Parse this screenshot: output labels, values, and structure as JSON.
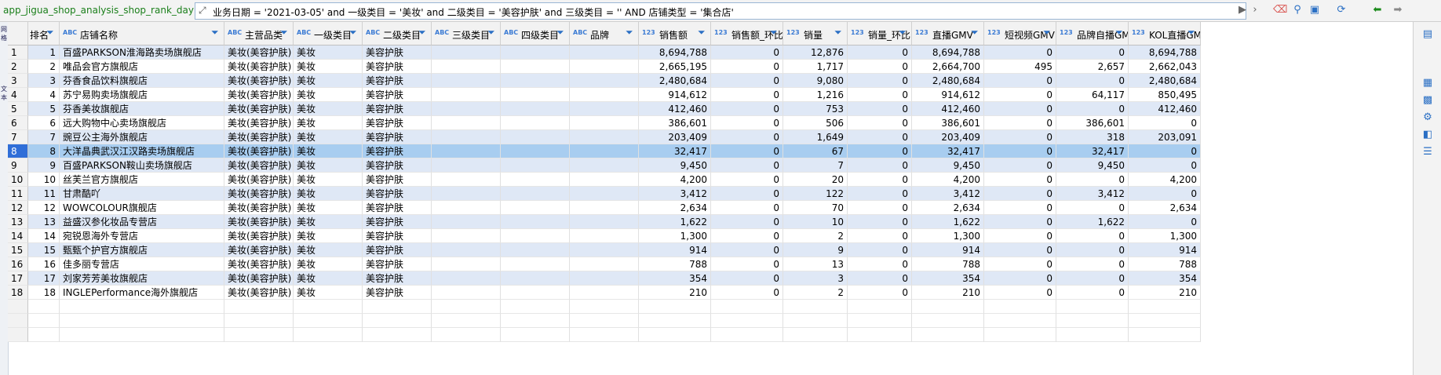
{
  "toolbar": {
    "table_name": "app_jigua_shop_analysis_shop_rank_day",
    "filter_text": "业务日期 = '2021-03-05' and 一级类目 = '美妆' and 二级类目 = '美容护肤' and 三级类目 = '' AND 店铺类型 = '集合店'",
    "icons": [
      "expand-icon",
      "play-icon",
      "next-icon",
      "eraser-icon",
      "filter-icon",
      "save-icon",
      "refresh-icon",
      "back-icon",
      "forward-icon"
    ]
  },
  "left_gutter": {
    "tabs": [
      "网格",
      "文本"
    ]
  },
  "grid": {
    "columns": [
      {
        "label": "排名",
        "type": ""
      },
      {
        "label": "店铺名称",
        "type": "ABC"
      },
      {
        "label": "主营品类",
        "type": "ABC"
      },
      {
        "label": "一级类目",
        "type": "ABC"
      },
      {
        "label": "二级类目",
        "type": "ABC"
      },
      {
        "label": "三级类目",
        "type": "ABC"
      },
      {
        "label": "四级类目",
        "type": "ABC"
      },
      {
        "label": "品牌",
        "type": "ABC"
      },
      {
        "label": "销售额",
        "type": "123"
      },
      {
        "label": "销售额_环比",
        "type": "123"
      },
      {
        "label": "销量",
        "type": "123"
      },
      {
        "label": "销量_环比",
        "type": "123"
      },
      {
        "label": "直播GMV",
        "type": "123"
      },
      {
        "label": "短视频GMV",
        "type": "123"
      },
      {
        "label": "品牌自播GMV",
        "type": "123"
      },
      {
        "label": "KOL直播GMV",
        "type": "123"
      }
    ],
    "selected_row": 8,
    "rows": [
      [
        "1",
        "百盛PARKSON淮海路卖场旗舰店",
        "美妆(美容护肤)",
        "美妆",
        "美容护肤",
        "",
        "",
        "",
        "8,694,788",
        "0",
        "12,876",
        "0",
        "8,694,788",
        "0",
        "0",
        "8,694,788"
      ],
      [
        "2",
        "唯品会官方旗舰店",
        "美妆(美容护肤)",
        "美妆",
        "美容护肤",
        "",
        "",
        "",
        "2,665,195",
        "0",
        "1,717",
        "0",
        "2,664,700",
        "495",
        "2,657",
        "2,662,043"
      ],
      [
        "3",
        "芬香食品饮料旗舰店",
        "美妆(美容护肤)",
        "美妆",
        "美容护肤",
        "",
        "",
        "",
        "2,480,684",
        "0",
        "9,080",
        "0",
        "2,480,684",
        "0",
        "0",
        "2,480,684"
      ],
      [
        "4",
        "苏宁易购卖场旗舰店",
        "美妆(美容护肤)",
        "美妆",
        "美容护肤",
        "",
        "",
        "",
        "914,612",
        "0",
        "1,216",
        "0",
        "914,612",
        "0",
        "64,117",
        "850,495"
      ],
      [
        "5",
        "芬香美妆旗舰店",
        "美妆(美容护肤)",
        "美妆",
        "美容护肤",
        "",
        "",
        "",
        "412,460",
        "0",
        "753",
        "0",
        "412,460",
        "0",
        "0",
        "412,460"
      ],
      [
        "6",
        "远大购物中心卖场旗舰店",
        "美妆(美容护肤)",
        "美妆",
        "美容护肤",
        "",
        "",
        "",
        "386,601",
        "0",
        "506",
        "0",
        "386,601",
        "0",
        "386,601",
        "0"
      ],
      [
        "7",
        "豌豆公主海外旗舰店",
        "美妆(美容护肤)",
        "美妆",
        "美容护肤",
        "",
        "",
        "",
        "203,409",
        "0",
        "1,649",
        "0",
        "203,409",
        "0",
        "318",
        "203,091"
      ],
      [
        "8",
        "大洋晶典武汉江汉路卖场旗舰店",
        "美妆(美容护肤)",
        "美妆",
        "美容护肤",
        "",
        "",
        "",
        "32,417",
        "0",
        "67",
        "0",
        "32,417",
        "0",
        "32,417",
        "0"
      ],
      [
        "9",
        "百盛PARKSON鞍山卖场旗舰店",
        "美妆(美容护肤)",
        "美妆",
        "美容护肤",
        "",
        "",
        "",
        "9,450",
        "0",
        "7",
        "0",
        "9,450",
        "0",
        "9,450",
        "0"
      ],
      [
        "10",
        "丝芙兰官方旗舰店",
        "美妆(美容护肤)",
        "美妆",
        "美容护肤",
        "",
        "",
        "",
        "4,200",
        "0",
        "20",
        "0",
        "4,200",
        "0",
        "0",
        "4,200"
      ],
      [
        "11",
        "甘肃酷吖",
        "美妆(美容护肤)",
        "美妆",
        "美容护肤",
        "",
        "",
        "",
        "3,412",
        "0",
        "122",
        "0",
        "3,412",
        "0",
        "3,412",
        "0"
      ],
      [
        "12",
        "WOWCOLOUR旗舰店",
        "美妆(美容护肤)",
        "美妆",
        "美容护肤",
        "",
        "",
        "",
        "2,634",
        "0",
        "70",
        "0",
        "2,634",
        "0",
        "0",
        "2,634"
      ],
      [
        "13",
        "益盛汉参化妆品专营店",
        "美妆(美容护肤)",
        "美妆",
        "美容护肤",
        "",
        "",
        "",
        "1,622",
        "0",
        "10",
        "0",
        "1,622",
        "0",
        "1,622",
        "0"
      ],
      [
        "14",
        "宛锐恩海外专营店",
        "美妆(美容护肤)",
        "美妆",
        "美容护肤",
        "",
        "",
        "",
        "1,300",
        "0",
        "2",
        "0",
        "1,300",
        "0",
        "0",
        "1,300"
      ],
      [
        "15",
        "甄甄个护官方旗舰店",
        "美妆(美容护肤)",
        "美妆",
        "美容护肤",
        "",
        "",
        "",
        "914",
        "0",
        "9",
        "0",
        "914",
        "0",
        "0",
        "914"
      ],
      [
        "16",
        "佳多丽专营店",
        "美妆(美容护肤)",
        "美妆",
        "美容护肤",
        "",
        "",
        "",
        "788",
        "0",
        "13",
        "0",
        "788",
        "0",
        "0",
        "788"
      ],
      [
        "17",
        "刘家芳芳美妆旗舰店",
        "美妆(美容护肤)",
        "美妆",
        "美容护肤",
        "",
        "",
        "",
        "354",
        "0",
        "3",
        "0",
        "354",
        "0",
        "0",
        "354"
      ],
      [
        "18",
        "INGLEPerformance海外旗舰店",
        "美妆(美容护肤)",
        "美妆",
        "美容护肤",
        "",
        "",
        "",
        "210",
        "0",
        "2",
        "0",
        "210",
        "0",
        "0",
        "210"
      ]
    ]
  }
}
